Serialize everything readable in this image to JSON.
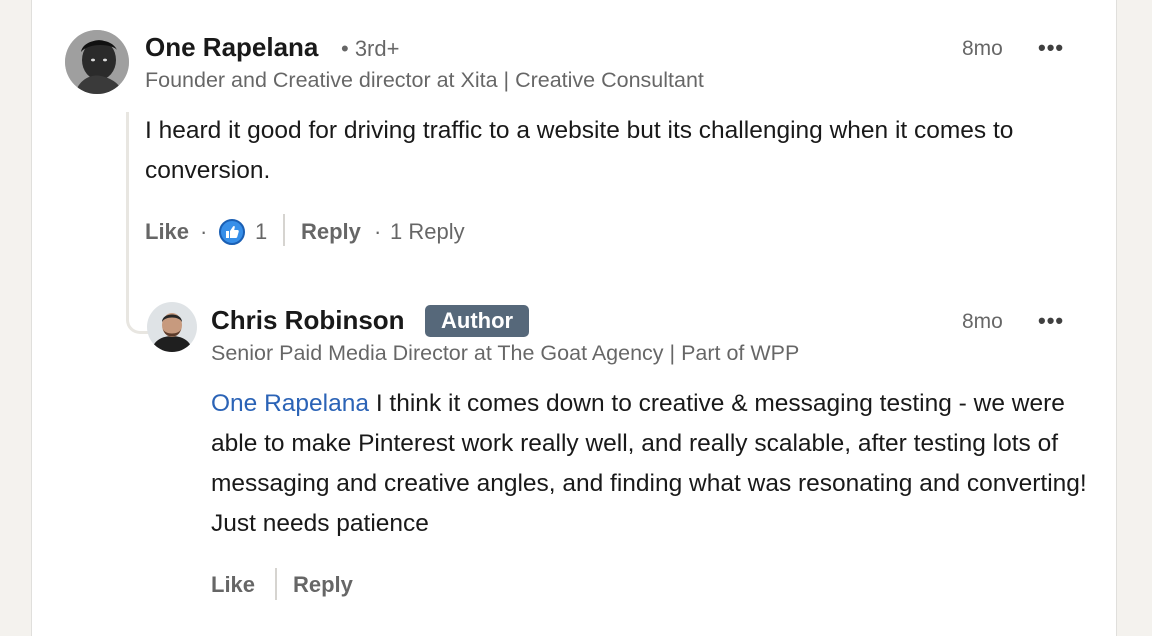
{
  "comment": {
    "author_name": "One Rapelana",
    "connection_degree": "• 3rd+",
    "headline": "Founder and Creative director at Xita | Creative Consultant",
    "time": "8mo",
    "more_label": "•••",
    "text": "I heard it good for driving traffic to a website but its challenging when it comes to conversion.",
    "like_label": "Like",
    "dot_sep": "·",
    "reaction_count": "1",
    "reply_label": "Reply",
    "replies_count_label": "1 Reply"
  },
  "reply": {
    "author_name": "Chris Robinson",
    "author_badge": "Author",
    "headline": "Senior Paid Media Director at The Goat Agency | Part of WPP",
    "time": "8mo",
    "more_label": "•••",
    "mention": "One Rapelana",
    "text": " I think it comes down to creative & messaging testing - we were able to make Pinterest work really well, and really scalable, after testing lots of messaging and creative angles, and finding what was resonating and converting! Just needs patience",
    "like_label": "Like",
    "reply_label": "Reply"
  },
  "icons": {
    "reaction": "thumbs-up-icon",
    "more": "more-options-icon"
  },
  "colors": {
    "mention": "#2b63b6",
    "author_badge_bg": "#56687a",
    "like_reaction": "#378fe9"
  }
}
